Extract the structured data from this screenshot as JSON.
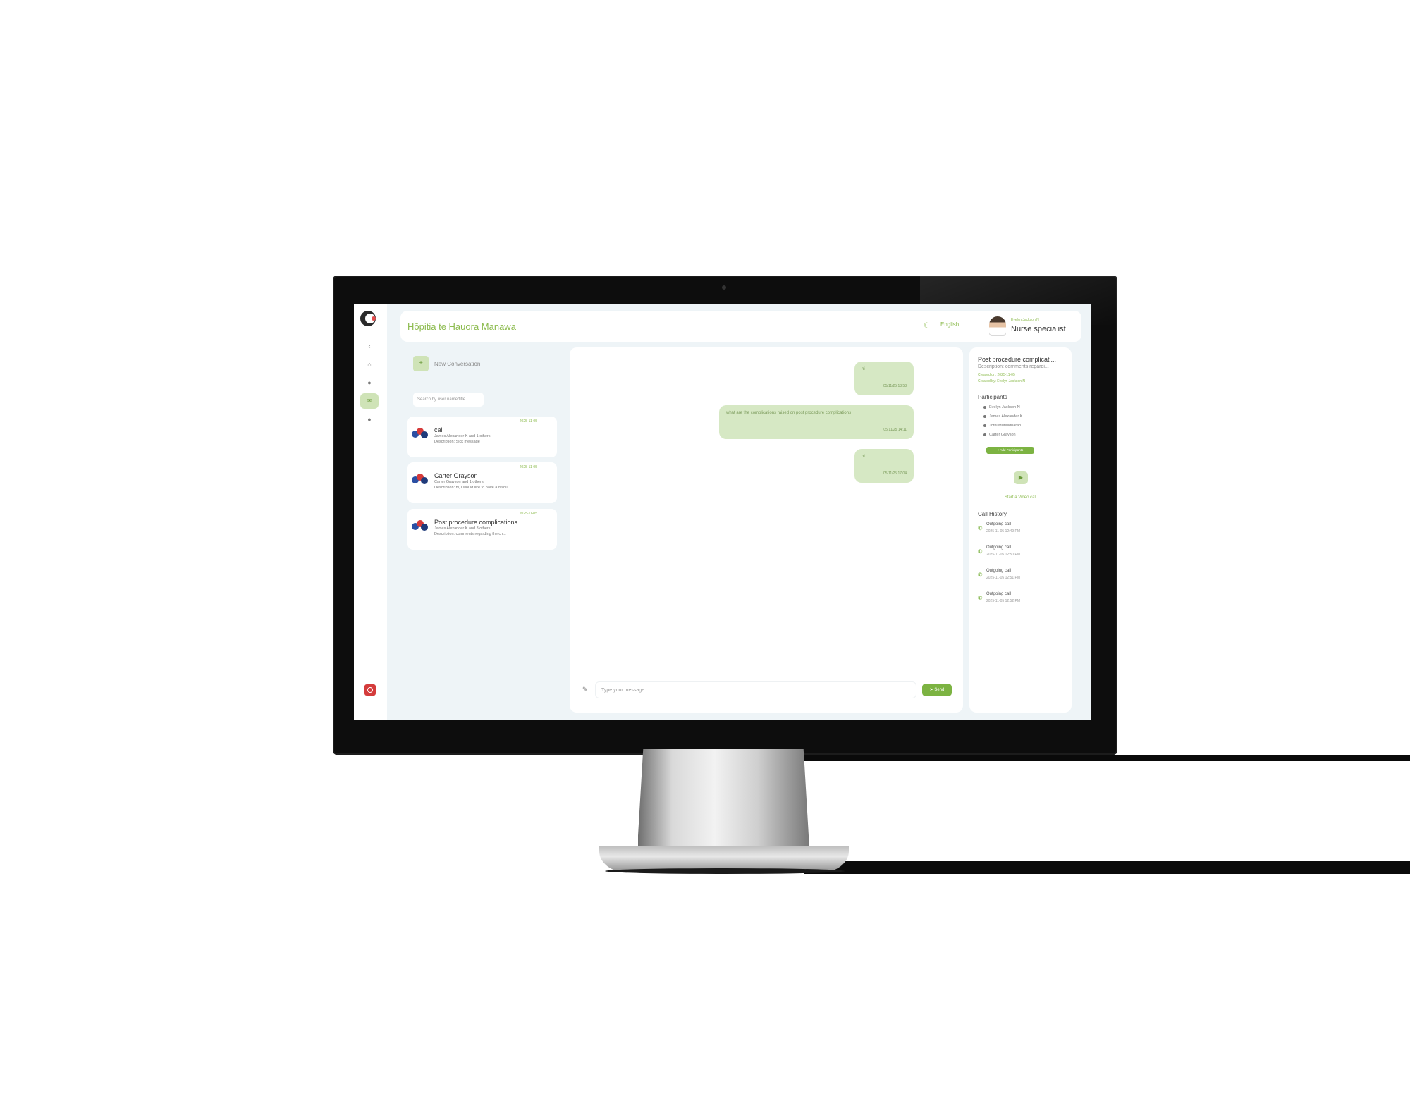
{
  "app": {
    "title": "Hōpitia te Hauora Manawa",
    "theme_icon": "moon-icon",
    "language_label": "English"
  },
  "user": {
    "name": "Evelyn Jackson N",
    "role": "Nurse specialist"
  },
  "nav": {
    "items": [
      "collapse-icon",
      "home-icon",
      "user-icon",
      "chat-icon",
      "profile-icon"
    ],
    "active": "chat-icon"
  },
  "conversations": {
    "new_label": "New Conversation",
    "search_placeholder": "Search by user name/title",
    "items": [
      {
        "title": "call",
        "date": "2025-11-05",
        "participants": "James Alexander K and 1 others",
        "description": "Description: Sick message"
      },
      {
        "title": "Carter Grayson",
        "date": "2025-11-05",
        "participants": "Carter Grayson and 1 others",
        "description": "Description: hi, I would like to have a discu..."
      },
      {
        "title": "Post procedure complications",
        "date": "2025-11-05",
        "participants": "James Alexander K and 3 others",
        "description": "Description: comments regarding the ch..."
      }
    ]
  },
  "chat": {
    "messages": [
      {
        "text": "hi",
        "time": "05/11/25 13:58"
      },
      {
        "text": "what are the complications raised on post procedure complications",
        "time": "05/11/25 14:11"
      },
      {
        "text": "hi",
        "time": "05/11/25 17:04"
      }
    ],
    "input_placeholder": "Type your message",
    "send_label": "Send"
  },
  "details": {
    "title": "Post procedure complicati...",
    "description": "Description: comments regardi...",
    "created_on": "Created on: 2025-11-05",
    "created_by": "Created by: Evelyn Jackson N",
    "participants_heading": "Participants",
    "participants": [
      "Evelyn Jackson N",
      "James Alexander K",
      "Jothi Muralidharan",
      "Carter Grayson"
    ],
    "add_participants_label": "+ Add Participants",
    "video_call_label": "Start a Video call",
    "call_history_heading": "Call History",
    "calls": [
      {
        "type": "Outgoing call",
        "time": "2025-11-05 12:49 PM"
      },
      {
        "type": "Outgoing call",
        "time": "2025-11-05 12:50 PM"
      },
      {
        "type": "Outgoing call",
        "time": "2025-11-05 12:51 PM"
      },
      {
        "type": "Outgoing call",
        "time": "2025-11-05 12:52 PM"
      }
    ]
  },
  "colors": {
    "accent": "#8cbb4e",
    "send_button": "#7cb342",
    "bubble": "#d6e8c4",
    "screen_bg": "#eef4f7",
    "logout": "#d43b3b"
  }
}
